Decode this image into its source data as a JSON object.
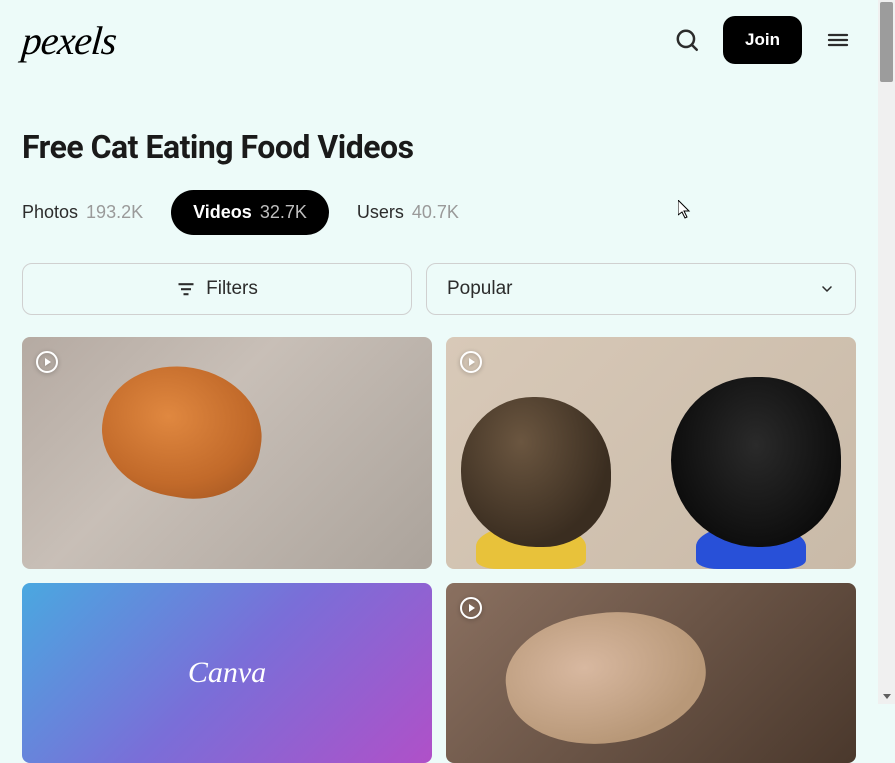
{
  "header": {
    "logo_text": "pexels",
    "join_label": "Join"
  },
  "page_title": "Free Cat Eating Food Videos",
  "tabs": [
    {
      "label": "Photos",
      "count": "193.2K",
      "active": false
    },
    {
      "label": "Videos",
      "count": "32.7K",
      "active": true
    },
    {
      "label": "Users",
      "count": "40.7K",
      "active": false
    }
  ],
  "controls": {
    "filters_label": "Filters",
    "sort_label": "Popular"
  },
  "ad": {
    "brand": "Canva"
  }
}
